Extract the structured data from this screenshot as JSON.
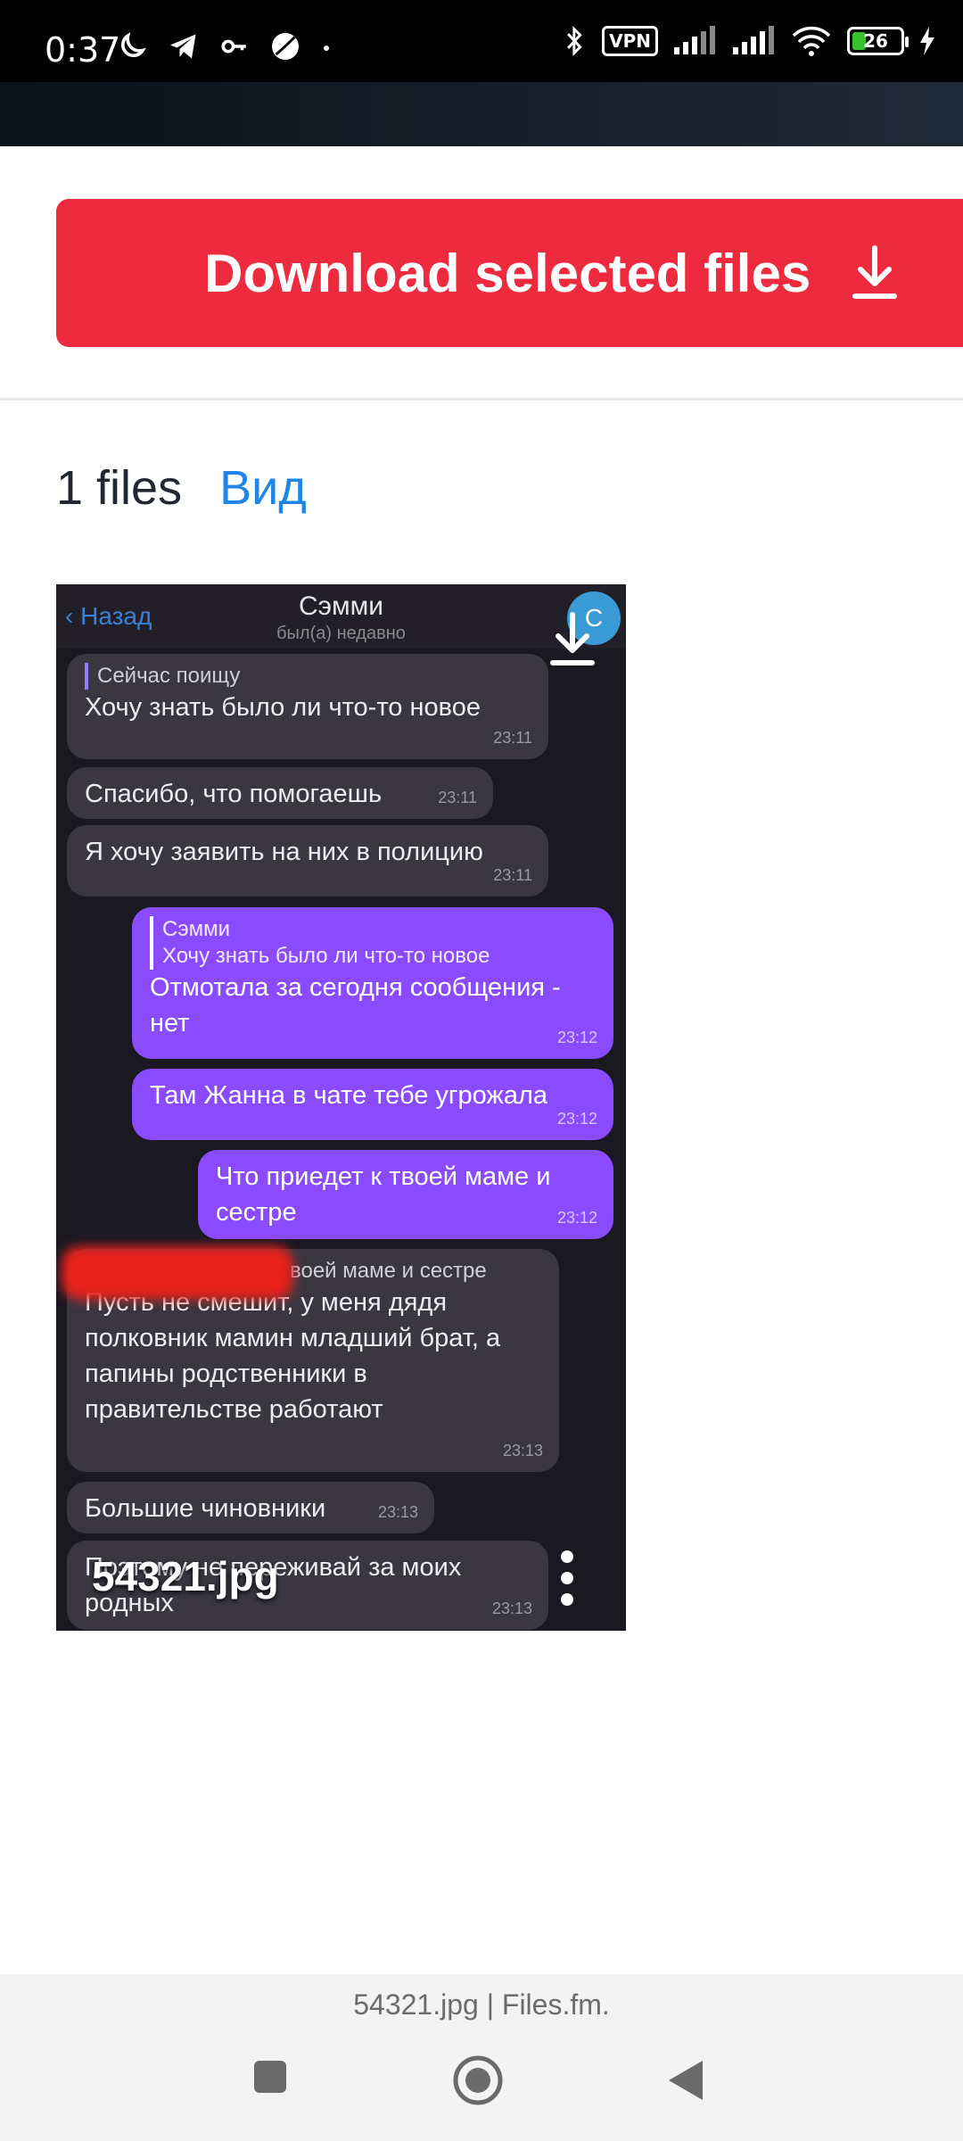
{
  "status_bar": {
    "time": "0:37",
    "vpn_label": "VPN",
    "battery_level": "26"
  },
  "download": {
    "label": "Download selected files"
  },
  "files": {
    "count_label": "1 files",
    "view_label": "Вид"
  },
  "thumbnail": {
    "file_name": "54321.jpg",
    "chat": {
      "back_label": "Назад",
      "contact_name": "Сэмми",
      "contact_status": "был(а) недавно",
      "avatar_letter": "С",
      "messages": [
        {
          "reply": "Сейчас поищу",
          "text": "Хочу знать было ли что-то новое",
          "time": "23:11"
        },
        {
          "text": "Спасибо, что помогаешь",
          "time": "23:11"
        },
        {
          "text": "Я хочу заявить на них в полицию",
          "time": "23:11"
        },
        {
          "reply_name": "Сэмми",
          "reply": "Хочу знать было ли что-то новое",
          "text": "Отмотала за сегодня сообщения - нет",
          "time": "23:12"
        },
        {
          "text": "Там Жанна в чате тебе угрожала",
          "time": "23:12"
        },
        {
          "text": "Что приедет к твоей маме и сестре",
          "time": "23:12"
        },
        {
          "reply": "воей маме и сестре",
          "text": "Пусть не смешит, у меня дядя полковник мамин младший брат, а папины родственники в правительстве работают",
          "time": "23:13"
        },
        {
          "text": "Большие чиновники",
          "time": "23:13"
        },
        {
          "text": "Поэтому не переживай за моих родных",
          "time": "23:13"
        }
      ]
    }
  },
  "footer": {
    "url_title": "54321.jpg | Files.fm."
  },
  "colors": {
    "accent": "#ee2a3e",
    "link": "#1f86e8",
    "outgoing_bubble": "#8a4bff"
  }
}
